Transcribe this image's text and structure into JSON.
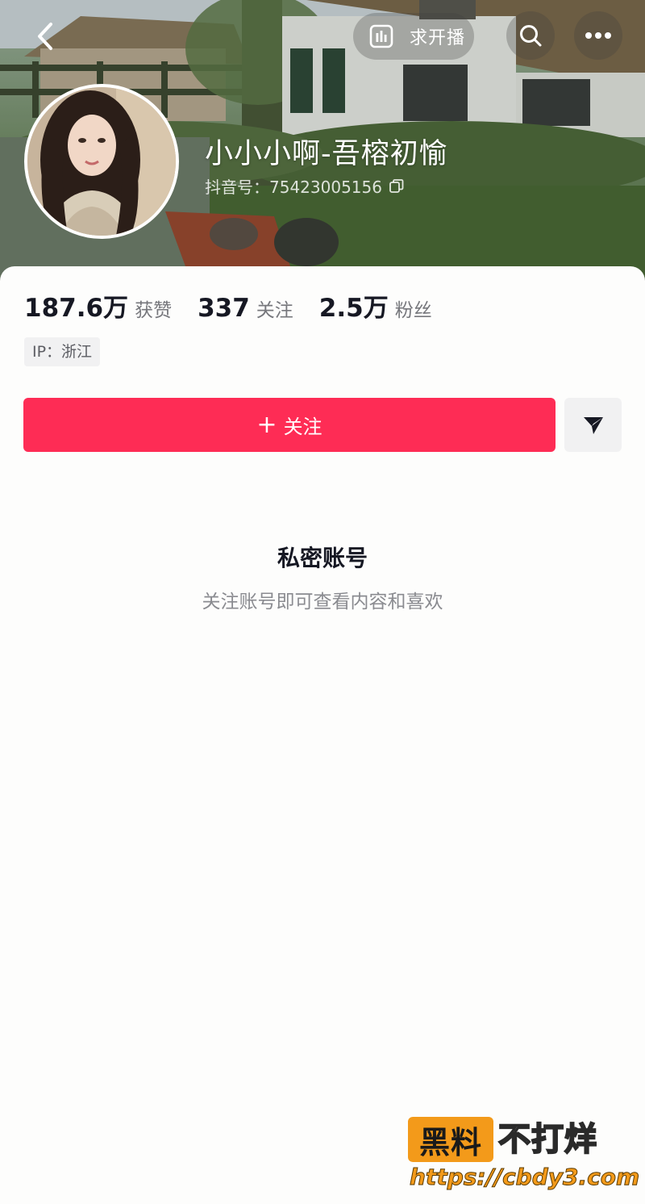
{
  "header": {
    "live_request_label": "求开播"
  },
  "profile": {
    "nickname": "小小小啊-吾榕初愉",
    "douyin_id": "抖音号：75423005156"
  },
  "stats": [
    {
      "value": "187.6万",
      "label": "获赞"
    },
    {
      "value": "337",
      "label": "关注"
    },
    {
      "value": "2.5万",
      "label": "粉丝"
    }
  ],
  "ip_tag": "IP：浙江",
  "actions": {
    "follow_label": "关注",
    "follow_plus": "+"
  },
  "private": {
    "title": "私密账号",
    "subtitle": "关注账号即可查看内容和喜欢"
  },
  "watermark": {
    "badge": "黑料",
    "text": "不打烊",
    "url": "https://cbdy3.com"
  },
  "colors": {
    "accent": "#fe2c55",
    "text_primary": "#161823",
    "text_secondary": "#76777c",
    "watermark_orange": "#f39a1a"
  },
  "icons": {
    "back": "chevron-left-icon",
    "live": "bar-chart-icon",
    "search": "search-icon",
    "more": "more-dots-icon",
    "copy": "copy-icon",
    "share": "send-arrow-icon"
  }
}
